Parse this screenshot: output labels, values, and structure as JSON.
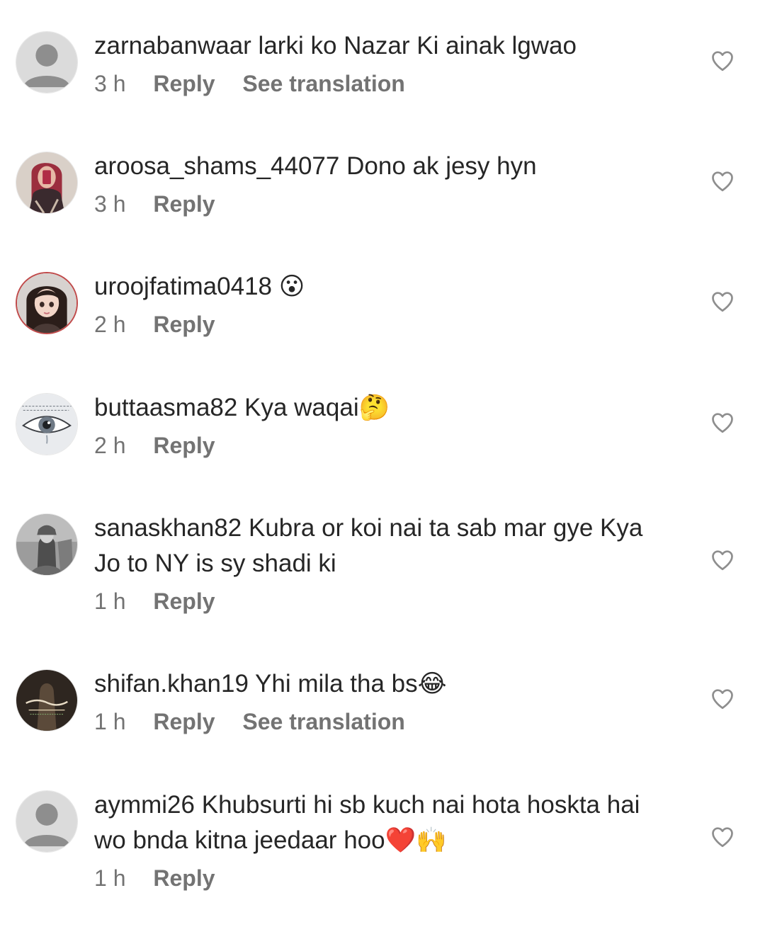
{
  "reply_label": "Reply",
  "see_translation_label": "See translation",
  "comments": [
    {
      "username": "zarnabanwaar",
      "text": "larki ko Nazar Ki ainak lgwao",
      "time": "3 h",
      "show_translation": true,
      "avatar": "default-avatar"
    },
    {
      "username": "aroosa_shams_44077",
      "text": "Dono ak jesy hyn",
      "time": "3 h",
      "show_translation": false,
      "avatar": "photo-avatar"
    },
    {
      "username": "uroojfatima0418",
      "text": "😮",
      "time": "2 h",
      "show_translation": false,
      "avatar": "illustrated-girl-avatar"
    },
    {
      "username": "buttaasma82",
      "text": "Kya waqai🤔",
      "time": "2 h",
      "show_translation": false,
      "avatar": "eye-sketch-avatar"
    },
    {
      "username": "sanaskhan82",
      "text": "Kubra or koi nai ta sab mar gye Kya Jo to NY is sy shadi ki",
      "time": "1 h",
      "show_translation": false,
      "avatar": "grayscale-photo-avatar"
    },
    {
      "username": "shifan.khan19",
      "text": "Yhi mila tha bs😂",
      "time": "1 h",
      "show_translation": true,
      "avatar": "calligraphy-avatar"
    },
    {
      "username": "aymmi26",
      "text": "Khubsurti hi sb kuch nai hota hoskta hai wo bnda kitna jeedaar hoo❤️🙌",
      "time": "1 h",
      "show_translation": false,
      "avatar": "default-avatar"
    }
  ]
}
